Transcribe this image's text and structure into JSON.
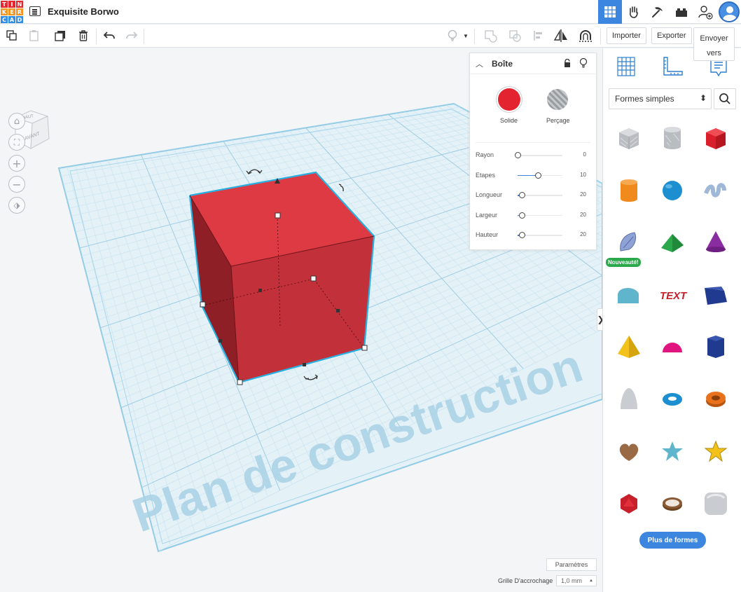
{
  "app": {
    "logo_letters": [
      "T",
      "I",
      "N",
      "K",
      "E",
      "R",
      "C",
      "A",
      "D"
    ],
    "logo_colors": [
      "#e8262f",
      "#e8262f",
      "#e8262f",
      "#f7941d",
      "#f7941d",
      "#f7941d",
      "#2f8de4",
      "#2f8de4",
      "#2f8de4"
    ],
    "project_title": "Exquisite Borwo"
  },
  "toolbar": {
    "import_label": "Importer",
    "export_label": "Exporter",
    "send_label": "Envoyer vers"
  },
  "viewcube": {
    "top_label": "HAUT",
    "front_label": "AVANT"
  },
  "workplane": {
    "watermark": "Plan de construction",
    "shape_color": "#d42e38"
  },
  "inspector": {
    "shape_name": "Boîte",
    "solid_label": "Solide",
    "hole_label": "Perçage",
    "solid_color": "#e3232f",
    "properties": [
      {
        "label": "Rayon",
        "value": "0",
        "level": 0.0
      },
      {
        "label": "Etapes",
        "value": "10",
        "level": 0.45
      },
      {
        "label": "Longueur",
        "value": "20",
        "level": 0.1
      },
      {
        "label": "Largeur",
        "value": "20",
        "level": 0.1
      },
      {
        "label": "Hauteur",
        "value": "20",
        "level": 0.1
      }
    ]
  },
  "footer": {
    "settings_label": "Paramètres",
    "snap_label": "Grille D'accrochage",
    "snap_value": "1,0 mm"
  },
  "shapes_panel": {
    "category": "Formes simples",
    "new_badge": "Nouveauté!",
    "more_label": "Plus de formes",
    "text_shape_label": "TEXT",
    "shapes": [
      {
        "name": "box-hole",
        "color": "#b9bcc0"
      },
      {
        "name": "cylinder-hole",
        "color": "#b9bcc0"
      },
      {
        "name": "box",
        "color": "#d91f2b"
      },
      {
        "name": "cylinder",
        "color": "#f08a1c"
      },
      {
        "name": "sphere",
        "color": "#1d8fd0"
      },
      {
        "name": "scribble",
        "color": "#9fb8d8"
      },
      {
        "name": "shape-generator",
        "color": "#8ea2d6"
      },
      {
        "name": "roof",
        "color": "#2aa84b"
      },
      {
        "name": "cone",
        "color": "#8a2da0"
      },
      {
        "name": "round-roof",
        "color": "#5fb6cc"
      },
      {
        "name": "text",
        "color": "#c8202a"
      },
      {
        "name": "wedge",
        "color": "#1f3a8f"
      },
      {
        "name": "pyramid",
        "color": "#f2c21a"
      },
      {
        "name": "half-sphere",
        "color": "#e0157f"
      },
      {
        "name": "polygon",
        "color": "#1f3a8f"
      },
      {
        "name": "paraboloid",
        "color": "#c9ccd0"
      },
      {
        "name": "torus",
        "color": "#1d8fd0"
      },
      {
        "name": "tube",
        "color": "#e8721c"
      },
      {
        "name": "heart",
        "color": "#9a6a45"
      },
      {
        "name": "star",
        "color": "#5fb6cc"
      },
      {
        "name": "star-yellow",
        "color": "#f2c21a"
      },
      {
        "name": "icosahedron",
        "color": "#c8202a"
      },
      {
        "name": "ring",
        "color": "#8a5a35"
      },
      {
        "name": "rounded-box",
        "color": "#c9ccd0"
      }
    ]
  }
}
